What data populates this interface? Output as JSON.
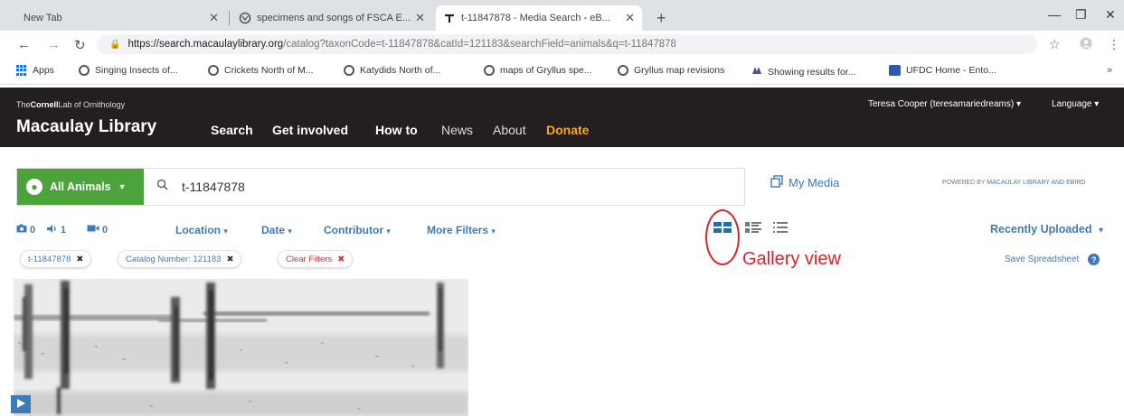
{
  "browser": {
    "tabs": [
      {
        "title": "New Tab",
        "active": false
      },
      {
        "title": "specimens and songs of FSCA E...",
        "active": false
      },
      {
        "title": "t-11847878 - Media Search - eB...",
        "active": true
      }
    ],
    "url_host": "https://search.macaulaylibrary.org",
    "url_path": "/catalog?taxonCode=t-11847878&catId=121183&searchField=animals&q=t-11847878",
    "bookmarks": [
      "Apps",
      "Singing Insects of...",
      "Crickets North of M...",
      "Katydids North of...",
      "maps of Gryllus spe...",
      "Gryllus map revisions",
      "Showing results for...",
      "UFDC Home - Ento..."
    ]
  },
  "header": {
    "org_prefix": "The",
    "org_name": "Cornell",
    "org_suffix": "Lab of Ornithology",
    "brand": "Macaulay Library",
    "nav": [
      "Search",
      "Get involved",
      "How to",
      "News",
      "About",
      "Donate"
    ],
    "user": "Teresa Cooper (teresamariedreams) ▾",
    "language": "Language ▾"
  },
  "search": {
    "taxon_button": "All Animals",
    "query": "t-11847878",
    "my_media": "My Media",
    "powered_by_prefix": "POWERED BY ",
    "powered_by_link": "MACAULAY LIBRARY AND EBIRD"
  },
  "filters": {
    "photo_count": "0",
    "audio_count": "1",
    "video_count": "0",
    "location": "Location",
    "date": "Date",
    "contributor": "Contributor",
    "more_filters": "More Filters",
    "sort": "Recently Uploaded"
  },
  "chips": {
    "taxon": "t-11847878",
    "catalog": "Catalog Number: 121183",
    "clear": "Clear Filters"
  },
  "annotation": {
    "label": "Gallery view",
    "color": "#d8242a"
  },
  "save_spreadsheet": "Save Spreadsheet",
  "colors": {
    "header_bg": "#231f20",
    "green": "#4ca33b",
    "link_blue": "#3d7ab8",
    "donate": "#f6a821"
  }
}
